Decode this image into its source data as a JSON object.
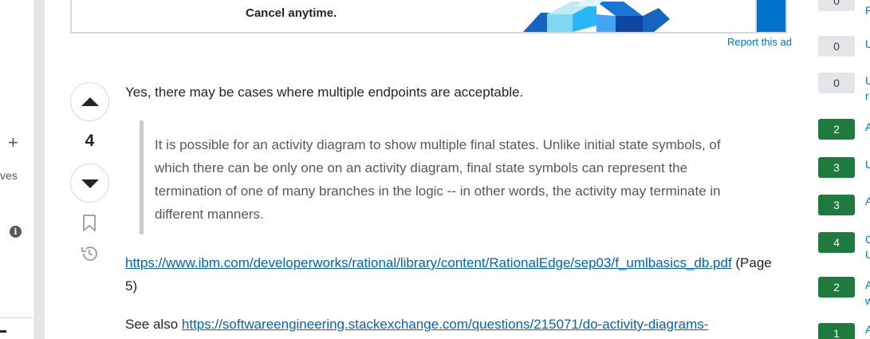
{
  "left_nav": {
    "plus_icon": "+",
    "partial_label": "ves",
    "info_icon": "i"
  },
  "ad": {
    "text": "Cancel anytime.",
    "report_link": "Report this ad"
  },
  "answer": {
    "vote_count": "4",
    "intro": "Yes, there may be cases where multiple endpoints are acceptable.",
    "quote": "It is possible for an activity diagram to show multiple final states. Unlike initial state symbols, of which there can be only one on an activity diagram, final state symbols can represent the termination of one of many branches in the logic -- in other words, the activity may terminate in different manners.",
    "source_link": "https://www.ibm.com/developerworks/rational/library/content/RationalEdge/sep03/f_umlbasics_db.pdf",
    "source_note": " (Page 5)",
    "see_also_prefix": "See also ",
    "see_also_link": "https://softwareengineering.stackexchange.com/questions/215071/do-activity-diagrams-"
  },
  "sidebar": {
    "items": [
      {
        "count": "0",
        "type": "zero",
        "text": "P"
      },
      {
        "count": "0",
        "type": "zero",
        "text": "U"
      },
      {
        "count": "0",
        "type": "zero",
        "text": "U"
      },
      {
        "count": "2",
        "type": "pos",
        "text": "A"
      },
      {
        "count": "3",
        "type": "pos",
        "text": "U"
      },
      {
        "count": "3",
        "type": "pos",
        "text": "A"
      },
      {
        "count": "4",
        "type": "pos",
        "text": "C"
      },
      {
        "count": "2",
        "type": "pos",
        "text": "A"
      },
      {
        "count": "1",
        "type": "pos",
        "text": "A"
      }
    ],
    "extra_letters": [
      "r",
      "U",
      "w"
    ]
  },
  "colors": {
    "link": "#0063bf",
    "accepted_green": "#1e7b3d",
    "zero_gray": "#e3e6e8",
    "quote_bar": "#c8ccd0"
  }
}
